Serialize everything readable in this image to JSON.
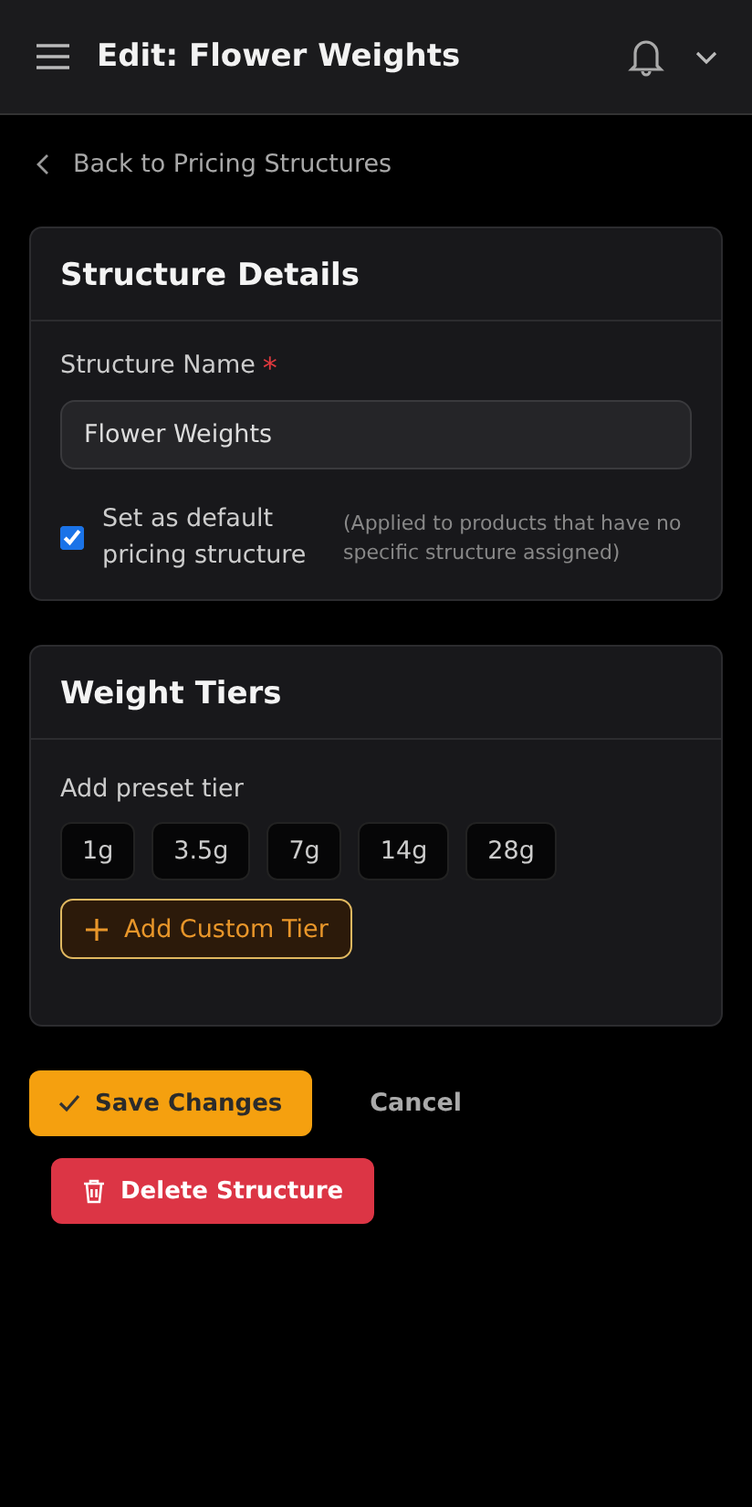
{
  "header": {
    "title": "Edit: Flower Weights"
  },
  "back_link": {
    "label": "Back to Pricing Structures"
  },
  "structure_details": {
    "title": "Structure Details",
    "name_label": "Structure Name",
    "required_mark": "*",
    "name_value": "Flower Weights",
    "default_checkbox": {
      "label": "Set as default pricing structure",
      "checked": true,
      "hint": "(Applied to products that have no specific structure assigned)"
    }
  },
  "weight_tiers": {
    "title": "Weight Tiers",
    "preset_label": "Add preset tier",
    "presets": [
      "1g",
      "3.5g",
      "7g",
      "14g",
      "28g"
    ],
    "custom_button": "Add Custom Tier"
  },
  "actions": {
    "save": "Save Changes",
    "cancel": "Cancel",
    "delete": "Delete Structure"
  }
}
